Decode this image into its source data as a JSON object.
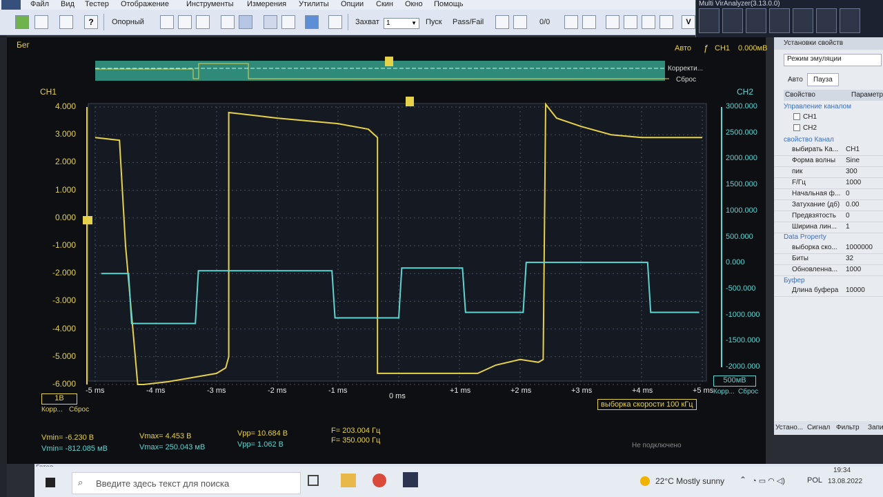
{
  "menu": [
    "Файл",
    "Вид",
    "Тестер",
    "Отображение",
    "Инструменты",
    "Измерения",
    "Утилиты",
    "Опции",
    "Скин",
    "Окно",
    "Помощь"
  ],
  "toolbar": {
    "trigger_mode": "Опорный",
    "capture_label": "Захват",
    "capture_value": "1",
    "start_label": "Пуск",
    "passfail_label": "Pass/Fail",
    "counter": "0/0"
  },
  "analyzer_window": {
    "title": "Multi VirAnalyzer(3.13.0.0)"
  },
  "scope": {
    "run_status": "Бег",
    "trigger_mode": "Авто",
    "trigger_channel": "CH1",
    "trigger_level": "0.000мВ",
    "ch1_label": "CH1",
    "ch2_label": "CH2",
    "overview_labels": [
      "Корректи...",
      "Сброс"
    ],
    "ch1_scale": "1В",
    "ch2_scale": "500мВ",
    "left_buttons": [
      "Корр...",
      "Сброс"
    ],
    "right_buttons": [
      "Корр...",
      "Сброс"
    ],
    "sample_rate": "выборка скорости 100 кГц",
    "ch1_ticks": [
      "4.000",
      "3.000",
      "2.000",
      "1.000",
      "0.000",
      "-1.000",
      "-2.000",
      "-3.000",
      "-4.000",
      "-5.000",
      "-6.000"
    ],
    "ch2_ticks": [
      "3000.000",
      "2500.000",
      "2000.000",
      "1500.000",
      "1000.000",
      "500.000",
      "0.000",
      "-500.000",
      "-1000.000",
      "-1500.000",
      "-2000.000"
    ],
    "time_ticks": [
      "-5 ms",
      "-4 ms",
      "-3 ms",
      "-2 ms",
      "-1 ms",
      "0 ms",
      "+1 ms",
      "+2 ms",
      "+3 ms",
      "+4 ms",
      "+5 ms"
    ]
  },
  "chart_data": {
    "type": "line",
    "x_unit": "ms",
    "xlim": [
      -5,
      5
    ],
    "series": [
      {
        "name": "CH1",
        "color": "#e6d14a",
        "y_unit": "V",
        "ylim": [
          -6,
          4
        ],
        "x": [
          -5.0,
          -4.6,
          -4.5,
          -4.3,
          -4.2,
          -3.8,
          -3.0,
          -2.85,
          -2.8,
          -2.8,
          -2.0,
          -1.0,
          -0.5,
          -0.4,
          -0.35,
          -0.35,
          1.3,
          1.6,
          2.0,
          2.3,
          2.38,
          2.42,
          2.6,
          3.0,
          3.5,
          4.0,
          5.0
        ],
        "y": [
          2.9,
          2.8,
          -1.0,
          -6.0,
          -6.0,
          -5.9,
          -5.6,
          -5.4,
          -5.0,
          3.8,
          3.6,
          3.4,
          3.2,
          3.0,
          2.9,
          -5.6,
          -5.6,
          -5.3,
          -5.1,
          -5.2,
          -5.1,
          4.1,
          3.6,
          3.3,
          3.0,
          2.9,
          2.9
        ]
      },
      {
        "name": "CH2",
        "color": "#5fd5d2",
        "y_unit": "mV",
        "ylim": [
          -2000,
          3000
        ],
        "x": [
          -4.9,
          -4.45,
          -4.4,
          -3.35,
          -3.3,
          -1.1,
          -1.05,
          0.0,
          0.05,
          1.05,
          1.1,
          2.05,
          2.1,
          4.1,
          4.15,
          4.95
        ],
        "y": [
          0,
          0,
          -900,
          -900,
          50,
          50,
          -800,
          -800,
          100,
          100,
          -700,
          -700,
          200,
          200,
          -700,
          -700
        ]
      }
    ]
  },
  "measurements": {
    "vmin1": "Vmin= -6.230 В",
    "vmin2": "Vmin= -812.085 мВ",
    "vmax1": "Vmax= 4.453 В",
    "vmax2": "Vmax= 250.043 мВ",
    "vpp1": "Vpp= 10.684 В",
    "vpp2": "Vpp= 1.062 В",
    "f1": "F= 203.004 Гц",
    "f2": "F= 350.000 Гц",
    "status": "Не подключено"
  },
  "properties": {
    "title": "Установки свойств",
    "mode": "Режим эмуляции",
    "tabs": [
      "Авто",
      "Пауза"
    ],
    "col_headers": [
      "Свойство",
      "Параметр"
    ],
    "group_channel_control": "Управление каналом",
    "ch1": "CH1",
    "ch2": "CH2",
    "group_channel_props": "свойство Канал",
    "rows": [
      {
        "k": "выбирать Ка...",
        "v": "CH1"
      },
      {
        "k": "Форма волны",
        "v": "Sine"
      },
      {
        "k": "пик",
        "v": "300"
      },
      {
        "k": "F/Гц",
        "v": "1000"
      },
      {
        "k": "Начальная ф...",
        "v": "0"
      },
      {
        "k": "Затухание (дб)",
        "v": "0.00"
      },
      {
        "k": "Предвзятость",
        "v": "0"
      },
      {
        "k": "Ширина лин...",
        "v": "1"
      }
    ],
    "group_data": "Data Property",
    "data_rows": [
      {
        "k": "выборка ско...",
        "v": "1000000"
      },
      {
        "k": "Биты",
        "v": "32"
      },
      {
        "k": "Обновленна...",
        "v": "1000"
      }
    ],
    "group_buffer": "Буфер",
    "buffer_rows": [
      {
        "k": "Длина буфера",
        "v": "10000"
      }
    ],
    "bottom_tabs": [
      "Устано...",
      "Сигнал",
      "Фильтр",
      "Запи"
    ]
  },
  "statusbar": {
    "left": "Готов"
  },
  "taskbar": {
    "search_placeholder": "Введите здесь текст для поиска",
    "weather": "22°C  Mostly sunny",
    "lang": "POL",
    "time": "19:34",
    "date": "13.08.2022"
  }
}
